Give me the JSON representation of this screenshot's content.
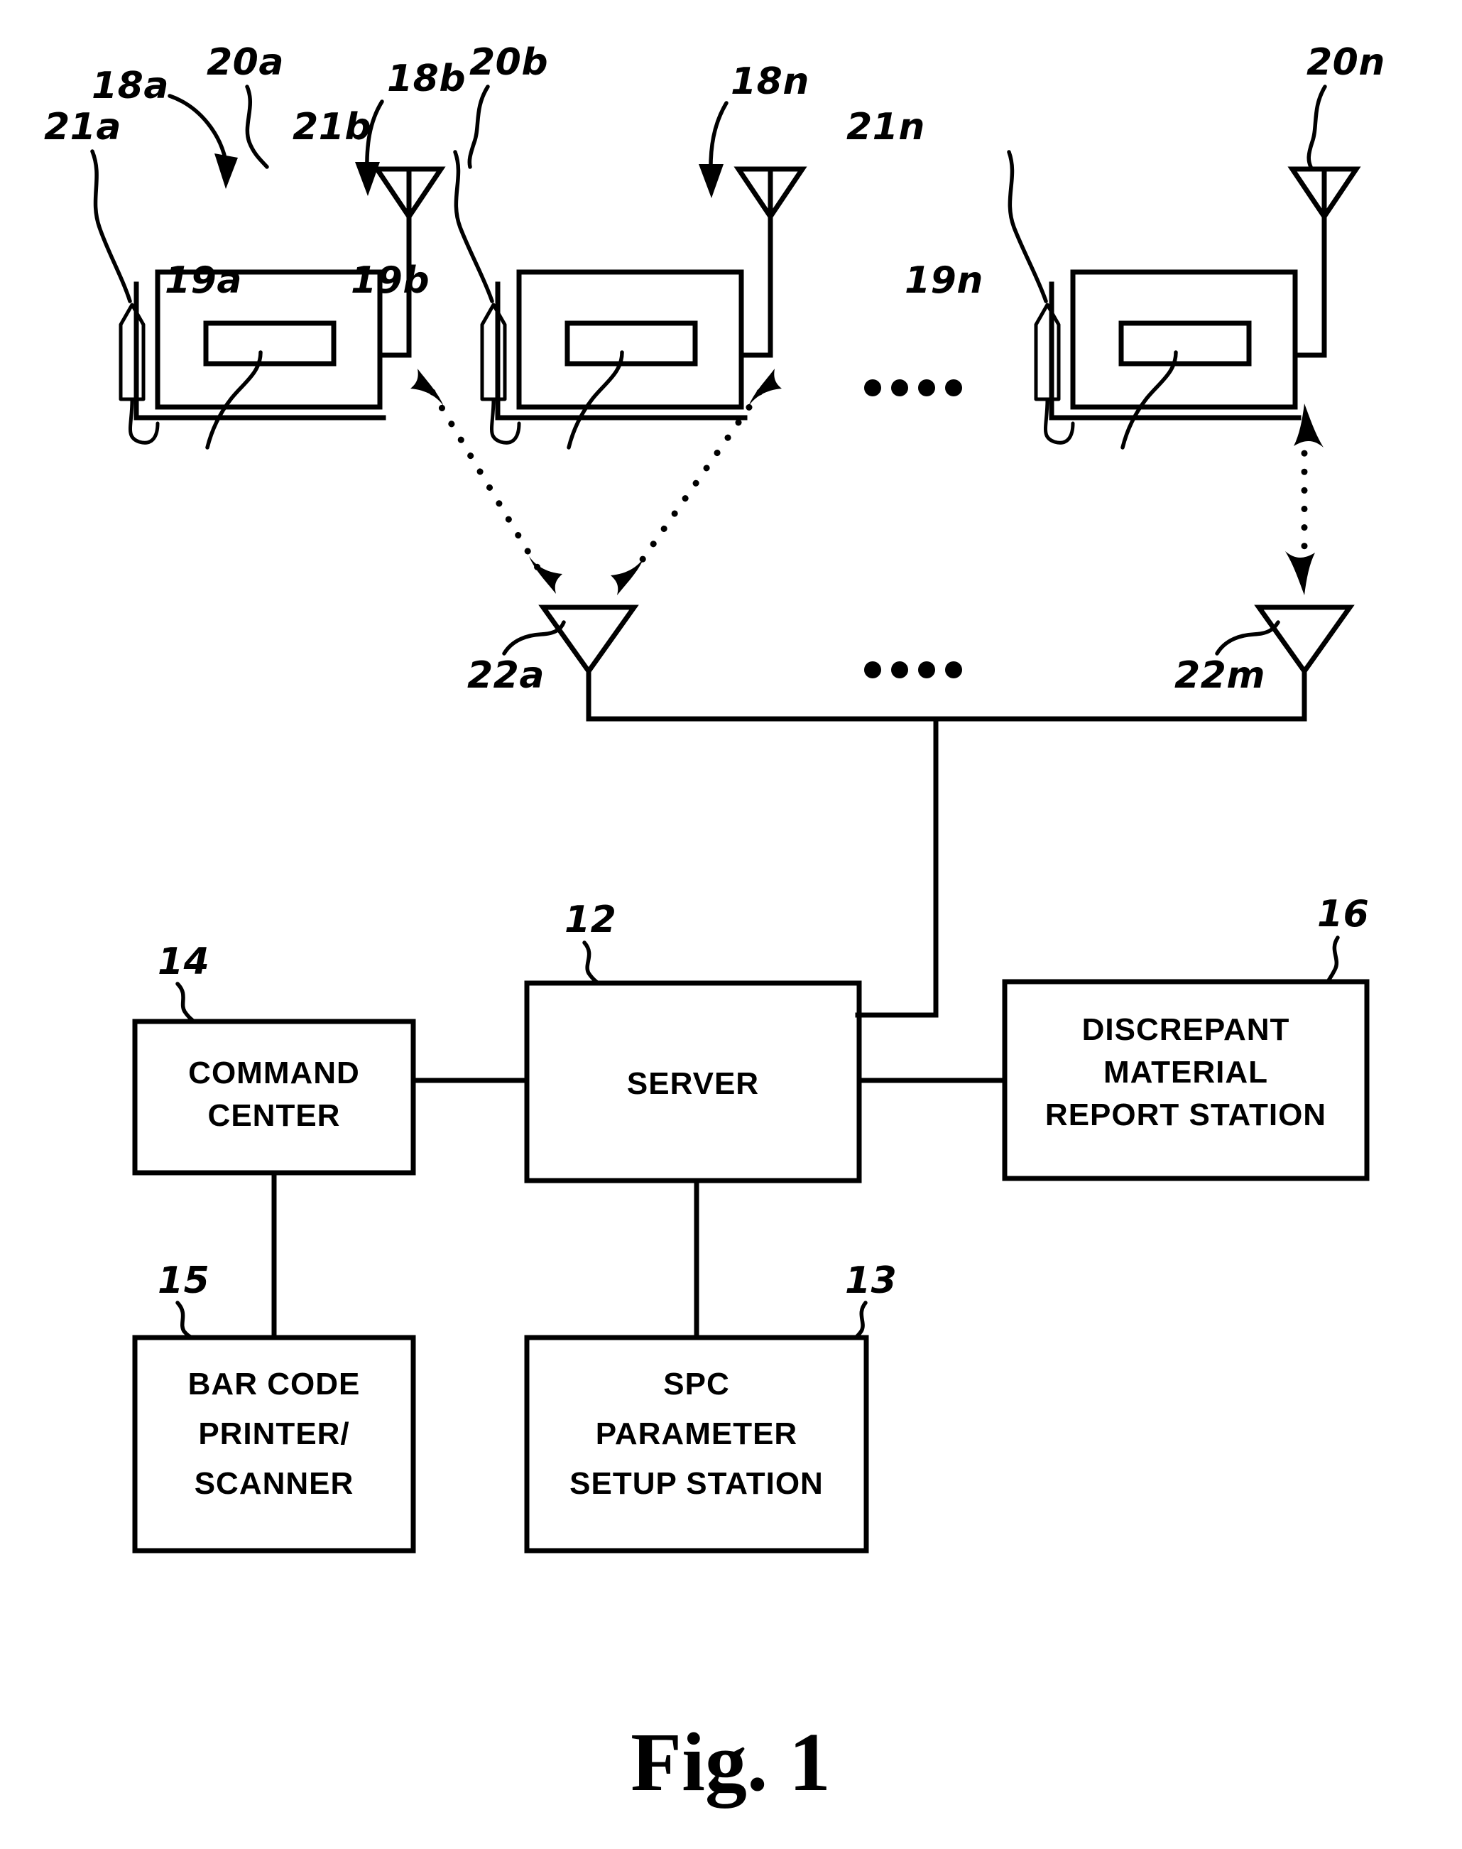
{
  "figure": {
    "caption": "Fig.  1",
    "title": "Patent Figure 1 - Wireless data collection system block diagram"
  },
  "mobile_units": [
    {
      "id": "a",
      "unit_ref": "18a",
      "antenna_ref": "20a",
      "stylus_ref": "21a",
      "screen_ref": "19a"
    },
    {
      "id": "b",
      "unit_ref": "18b",
      "antenna_ref": "20b",
      "stylus_ref": "21b",
      "screen_ref": "19b"
    },
    {
      "id": "n",
      "unit_ref": "18n",
      "antenna_ref": "20n",
      "stylus_ref": "21n",
      "screen_ref": "19n"
    }
  ],
  "base_antennas": [
    {
      "ref": "22a"
    },
    {
      "ref": "22m"
    }
  ],
  "ellipses": {
    "upper_dots": 4,
    "lower_dots": 4
  },
  "blocks": [
    {
      "key": "command_center",
      "ref": "14",
      "lines": [
        "COMMAND",
        "CENTER"
      ]
    },
    {
      "key": "server",
      "ref": "12",
      "lines": [
        "SERVER"
      ]
    },
    {
      "key": "discrepant_material_report_station",
      "ref": "16",
      "lines": [
        "DISCREPANT",
        "MATERIAL",
        "REPORT STATION"
      ]
    },
    {
      "key": "bar_code_printer_scanner",
      "ref": "15",
      "lines": [
        "BAR CODE",
        "PRINTER/",
        "SCANNER"
      ]
    },
    {
      "key": "spc_parameter_setup_station",
      "ref": "13",
      "lines": [
        "SPC",
        "PARAMETER",
        "SETUP STATION"
      ]
    }
  ],
  "colors": {
    "ink": "#000000",
    "paper": "#ffffff"
  }
}
